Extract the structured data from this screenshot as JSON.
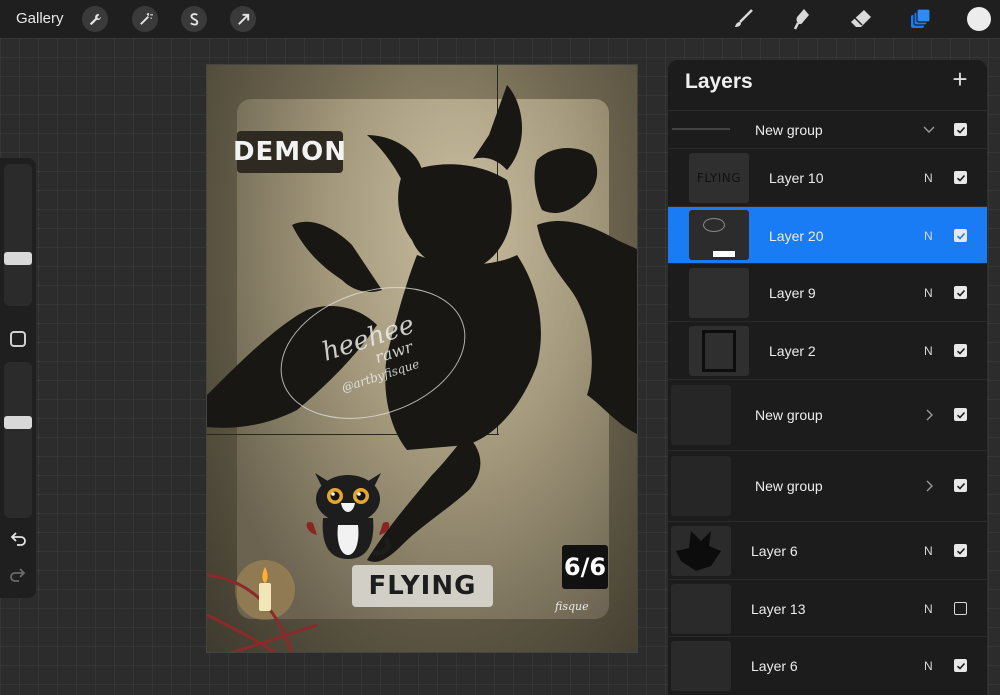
{
  "toolbar": {
    "gallery_label": "Gallery",
    "left_tools": [
      "wrench-icon",
      "magic-wand-icon",
      "selection-icon",
      "transform-arrow-icon"
    ],
    "right_tools": [
      "brush-icon",
      "smudge-icon",
      "eraser-icon",
      "layers-icon"
    ],
    "active_color": "#ececec",
    "accent": "#1a7cf5"
  },
  "sidebar": {
    "brush_size_level": 0.32,
    "opacity_level": 0.62
  },
  "canvas": {
    "demon_label": "DEMON",
    "flying_label": "FLYING",
    "score_label": "6/6",
    "watermark_line1": "heehee",
    "watermark_line2": "rawr",
    "watermark_line3": "@artbyfisque",
    "signature": "fisque"
  },
  "layers": {
    "title": "Layers",
    "items": [
      {
        "name": "New group",
        "mode": "",
        "visible": true,
        "kind": "group-open"
      },
      {
        "name": "Layer 10",
        "mode": "N",
        "visible": true,
        "kind": "layer",
        "thumb_text": "FLYING"
      },
      {
        "name": "Layer 20",
        "mode": "N",
        "visible": true,
        "kind": "layer",
        "active": true
      },
      {
        "name": "Layer 9",
        "mode": "N",
        "visible": true,
        "kind": "layer"
      },
      {
        "name": "Layer 2",
        "mode": "N",
        "visible": true,
        "kind": "layer"
      },
      {
        "name": "New group",
        "mode": "",
        "visible": true,
        "kind": "group-closed"
      },
      {
        "name": "New group",
        "mode": "",
        "visible": true,
        "kind": "group-closed"
      },
      {
        "name": "Layer 6",
        "mode": "N",
        "visible": true,
        "kind": "layer"
      },
      {
        "name": "Layer 13",
        "mode": "N",
        "visible": false,
        "kind": "layer"
      },
      {
        "name": "Layer 6",
        "mode": "N",
        "visible": true,
        "kind": "layer"
      }
    ]
  }
}
